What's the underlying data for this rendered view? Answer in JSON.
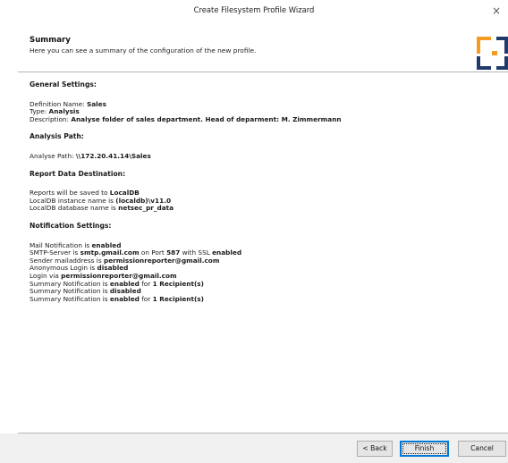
{
  "window": {
    "title": "Create Filesystem Profile Wizard",
    "close_label": "×"
  },
  "header": {
    "title": "Summary",
    "subtitle": "Here you can see a summary of the configuration of the new profile."
  },
  "sections": {
    "general": {
      "heading": "General Settings:",
      "definition_name_label": "Definition Name: ",
      "definition_name": "Sales",
      "type_label": "Type: ",
      "type": "Analysis",
      "description_label": "Description: ",
      "description": "Analyse folder of sales department. Head of deparment: M. Zimmermann"
    },
    "analysis": {
      "heading": "Analysis Path:",
      "path_label": "Analyse Path: ",
      "path": "\\\\172.20.41.14\\Sales"
    },
    "report": {
      "heading": "Report Data Destination:",
      "saved_label": "Reports will be saved to ",
      "saved_value": "LocalDB",
      "instance_label": "LocalDB instance name is ",
      "instance_value": "(localdb)\\v11.0",
      "db_label": "LocalDB database name is ",
      "db_value": "netsec_pr_data"
    },
    "notification": {
      "heading": "Notification Settings:",
      "mail_label": "Mail Notification is ",
      "mail_value": "enabled",
      "smtp_label": "SMTP-Server is ",
      "smtp_value": "smtp.gmail.com",
      "port_label": " on Port ",
      "port_value": "587",
      "ssl_label": " with SSL ",
      "ssl_value": "enabled",
      "sender_label": "Sender mailaddress is ",
      "sender_value": "permissionreporter@gmail.com",
      "anon_label": "Anonymous Login is ",
      "anon_value": "disabled",
      "login_label": "Login via ",
      "login_value": "permissionreporter@gmail.com",
      "summary1_label": "Summary Notification is ",
      "summary1_value": "enabled",
      "summary1_for": " for ",
      "summary1_count": "1 Recipient(s)",
      "summary2_label": "Summary Notification is ",
      "summary2_value": "disabled",
      "summary3_label": "Summary Notification is ",
      "summary3_value": "enabled",
      "summary3_for": " for ",
      "summary3_count": "1 Recipient(s)"
    }
  },
  "buttons": {
    "back": "< Back",
    "finish": "Finish",
    "cancel": "Cancel"
  },
  "colors": {
    "logo_orange": "#f39c21",
    "logo_navy": "#1f3a6b",
    "accent": "#0078d7"
  }
}
